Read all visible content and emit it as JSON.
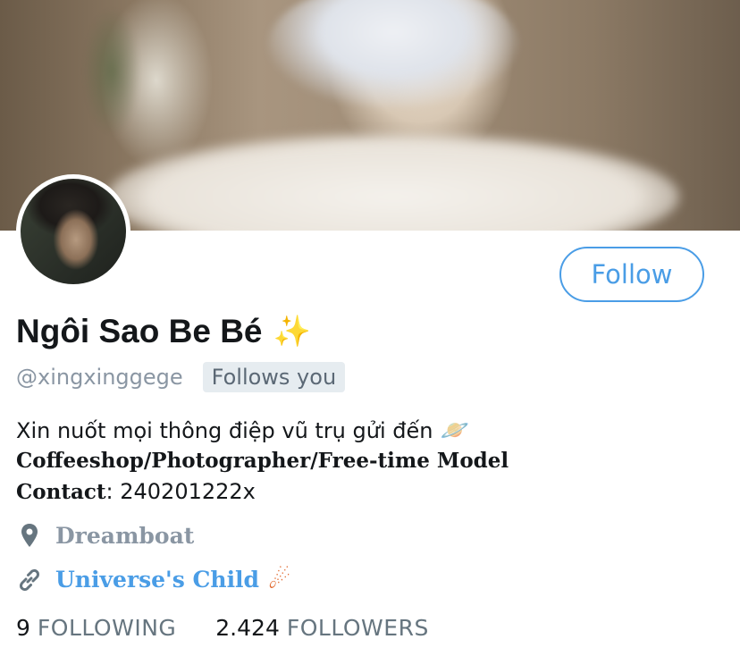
{
  "profile": {
    "display_name": "Ngôi Sao Be Bé",
    "name_emoji": "✨",
    "handle": "@xingxinggege",
    "follows_you_badge": "Follows you",
    "follow_button": "Follow"
  },
  "bio": {
    "line1": "Xin nuốt mọi thông điệp vũ trụ gửi đến",
    "line1_emoji": "🪐",
    "line2": "Coffeeshop/Photographer/Free-time Model",
    "contact_label": "Contact",
    "contact_value": ": 240201222x"
  },
  "meta": {
    "location": "Dreamboat",
    "website": "Universe's Child",
    "website_emoji": "☄"
  },
  "stats": {
    "following_count": "9",
    "following_label": "FOLLOWING",
    "followers_count": "2.424",
    "followers_label": "FOLLOWERS"
  },
  "colors": {
    "accent": "#4a9de6",
    "secondary_text": "#8a96a3",
    "primary_text": "#14171a",
    "badge_bg": "#e6ecf0"
  },
  "icons": {
    "location": "map-pin-icon",
    "link": "link-icon"
  }
}
